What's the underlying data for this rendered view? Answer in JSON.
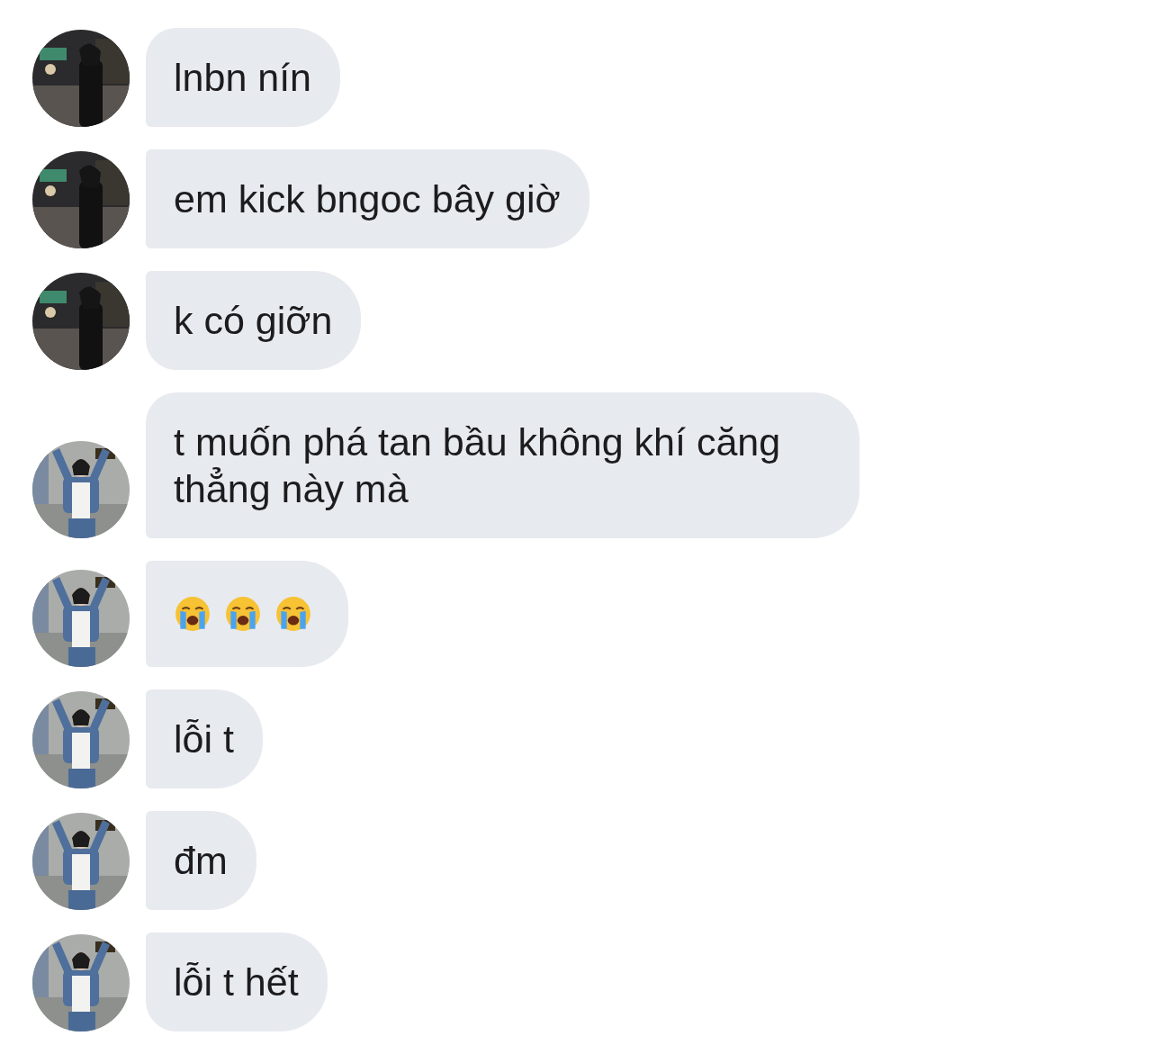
{
  "messages": [
    {
      "avatar": {
        "kind": "night"
      },
      "kind": "text",
      "text": "lnbn nín"
    },
    {
      "avatar": {
        "kind": "night"
      },
      "kind": "text",
      "text": "em kick bngoc bây giờ"
    },
    {
      "avatar": {
        "kind": "night"
      },
      "kind": "text",
      "text": "k có giỡn"
    },
    {
      "avatar": {
        "kind": "subway"
      },
      "kind": "text",
      "text": "t muốn phá tan bầu không khí căng thẳng này mà"
    },
    {
      "avatar": {
        "kind": "subway"
      },
      "kind": "emoji",
      "emojis": [
        {
          "kind": "crying"
        },
        {
          "kind": "crying"
        },
        {
          "kind": "crying"
        }
      ]
    },
    {
      "avatar": {
        "kind": "subway"
      },
      "kind": "text",
      "text": "lỗi t"
    },
    {
      "avatar": {
        "kind": "subway"
      },
      "kind": "text",
      "text": "đm"
    },
    {
      "avatar": {
        "kind": "subway"
      },
      "kind": "text",
      "text": "lỗi t hết"
    }
  ]
}
